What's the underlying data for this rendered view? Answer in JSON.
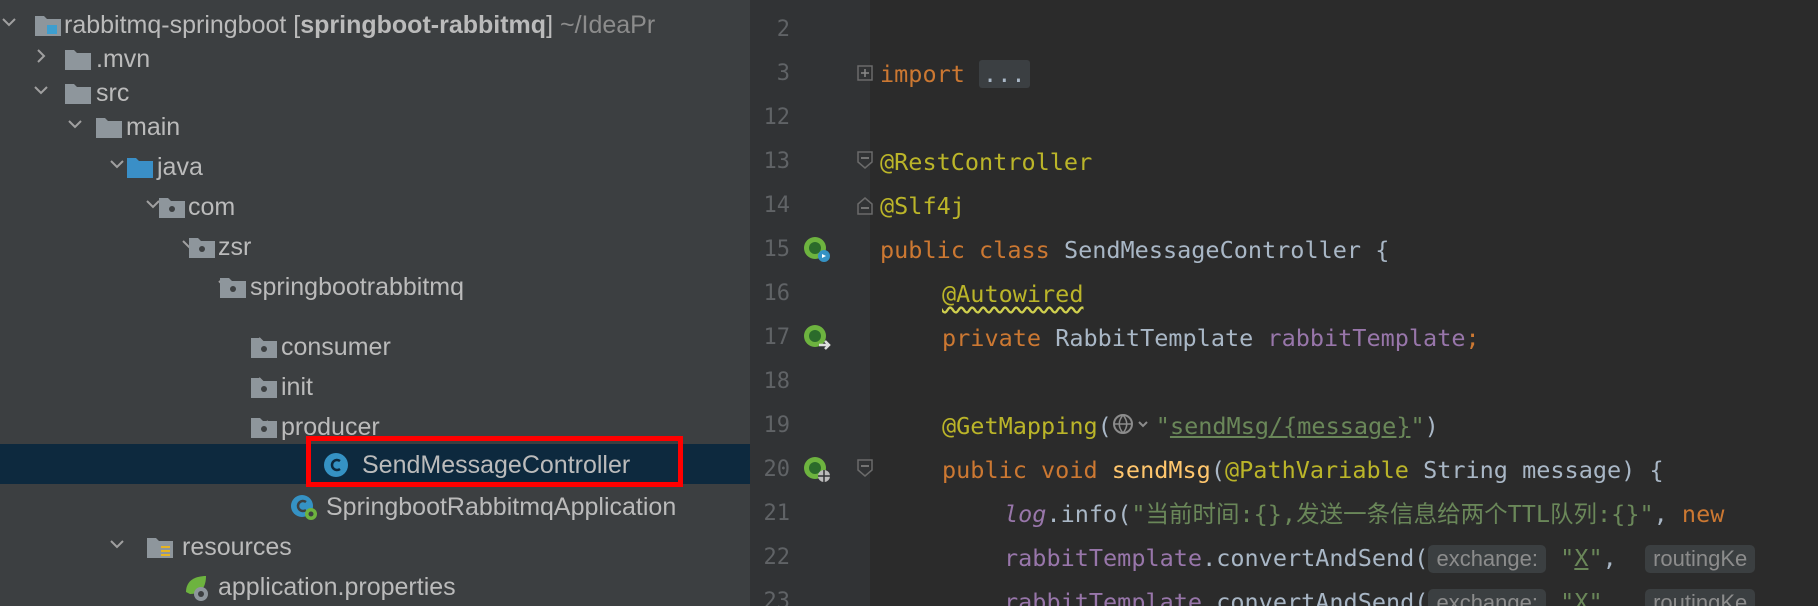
{
  "project": {
    "name": "rabbitmq-springboot",
    "module": "springboot-rabbitmq",
    "path": "~/IdeaPr",
    "tree": [
      {
        "label": ".mvn",
        "type": "folder"
      },
      {
        "label": "src",
        "type": "folder"
      },
      {
        "label": "main",
        "type": "folder"
      },
      {
        "label": "java",
        "type": "source-folder"
      },
      {
        "label": "com",
        "type": "package"
      },
      {
        "label": "zsr",
        "type": "package"
      },
      {
        "label": "springbootrabbitmq",
        "type": "package"
      },
      {
        "label": "consumer",
        "type": "package"
      },
      {
        "label": "init",
        "type": "package"
      },
      {
        "label": "producer",
        "type": "package"
      },
      {
        "label": "SendMessageController",
        "type": "class",
        "selected": true
      },
      {
        "label": "SpringbootRabbitmqApplication",
        "type": "spring-class"
      },
      {
        "label": "resources",
        "type": "resources-folder"
      },
      {
        "label": "application.properties",
        "type": "properties"
      }
    ]
  },
  "editor": {
    "line_numbers": [
      "2",
      "3",
      "12",
      "13",
      "14",
      "15",
      "16",
      "17",
      "18",
      "19",
      "20",
      "21",
      "22",
      "23"
    ],
    "tokens": {
      "import_kw": "import",
      "import_fold": "...",
      "rest_controller": "@RestController",
      "slf4j": "@Slf4j",
      "public_class": "public class ",
      "class_name": "SendMessageController {",
      "autowired": "@Autowired",
      "private_kw": "private ",
      "field_type": "RabbitTemplate ",
      "field_name": "rabbitTemplate",
      "semicolon": ";",
      "get_mapping": "@GetMapping",
      "open_paren": "(",
      "quote": "\"",
      "mapping_path": "sendMsg/{message}",
      "close_paren": ")",
      "public_void": "public void ",
      "method_name": "sendMsg",
      "path_variable": "@PathVariable",
      "param": " String message) {",
      "log": "log",
      "info_call": ".info(",
      "log_msg": "\"当前时间:{},发送一条信息给两个TTL队列:{}\"",
      "comma": ", ",
      "new_kw": "new",
      "rabbit_template": "rabbitTemplate",
      "convert_send": ".convertAndSend(",
      "hint_exchange": "exchange:",
      "x_value": "X",
      "hint_routing": "routingKe"
    }
  },
  "colors": {
    "selection": "#0d293e",
    "highlight_box": "#ff0000",
    "keyword": "#cc7832",
    "annotation": "#bbb529",
    "string": "#6a8759"
  }
}
